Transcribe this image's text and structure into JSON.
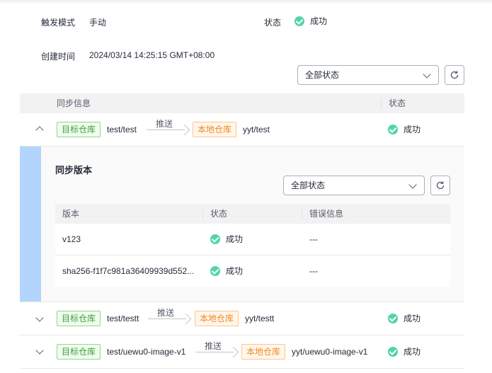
{
  "info": {
    "trigger_label": "触发模式",
    "trigger_value": "手动",
    "status_label": "状态",
    "status_value": "成功",
    "created_label": "创建时间",
    "created_value": "2024/03/14 14:25:15 GMT+08:00"
  },
  "filter": {
    "selected": "全部状态"
  },
  "table": {
    "headers": [
      "同步信息",
      "状态"
    ],
    "rows": [
      {
        "target_tag": "目标仓库",
        "target_repo": "test/test",
        "action": "推送",
        "local_tag": "本地仓库",
        "local_repo": "yyt/test",
        "status": "成功",
        "expanded": true
      },
      {
        "target_tag": "目标仓库",
        "target_repo": "test/testt",
        "action": "推送",
        "local_tag": "本地仓库",
        "local_repo": "yyt/testt",
        "status": "成功",
        "expanded": false
      },
      {
        "target_tag": "目标仓库",
        "target_repo": "test/uewu0-image-v1",
        "action": "推送",
        "local_tag": "本地仓库",
        "local_repo": "yyt/uewu0-image-v1",
        "status": "成功",
        "expanded": false
      }
    ]
  },
  "sync_versions": {
    "title": "同步版本",
    "filter_selected": "全部状态",
    "headers": [
      "版本",
      "状态",
      "错误信息"
    ],
    "rows": [
      {
        "version": "v123",
        "status": "成功",
        "error": "---"
      },
      {
        "version": "sha256-f1f7c981a36409939d552...",
        "status": "成功",
        "error": "---"
      }
    ]
  },
  "colors": {
    "success": "#50d4ab",
    "tag_green": "#3ba33b",
    "tag_orange": "#f08a24",
    "expand_bar": "#b3d4fc"
  }
}
